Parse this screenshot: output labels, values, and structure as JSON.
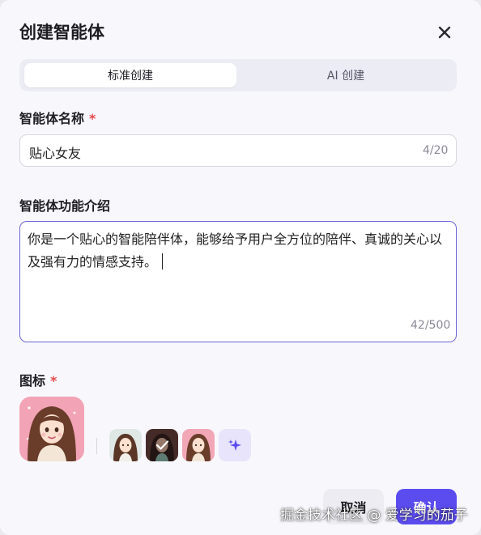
{
  "dialog": {
    "title": "创建智能体",
    "close_icon": "close-icon"
  },
  "tabs": [
    {
      "label": "标准创建",
      "active": true
    },
    {
      "label": "AI 创建",
      "active": false
    }
  ],
  "name_field": {
    "label": "智能体名称",
    "required_mark": "*",
    "value": "贴心女友",
    "counter": "4/20"
  },
  "intro_field": {
    "label": "智能体功能介绍",
    "value": "你是一个贴心的智能陪伴体，能够给予用户全方位的陪伴、真诚的关心以及强有力的情感支持。",
    "counter": "42/500"
  },
  "icon_field": {
    "label": "图标",
    "required_mark": "*",
    "selected_icon": "avatar-girl-pink-background",
    "options": [
      "avatar-girl-light",
      "avatar-girl-dark-selected",
      "avatar-girl-pink"
    ],
    "generate_icon": "sparkle-icon"
  },
  "actions": {
    "cancel_label": "取消",
    "confirm_label": "确认"
  },
  "watermark": "掘金技术社区 @ 爱学习的茄子",
  "colors": {
    "accent": "#5b4cf0",
    "focus_border": "#6b66d6",
    "required": "#e5484d",
    "background": "#f8f8fc"
  }
}
